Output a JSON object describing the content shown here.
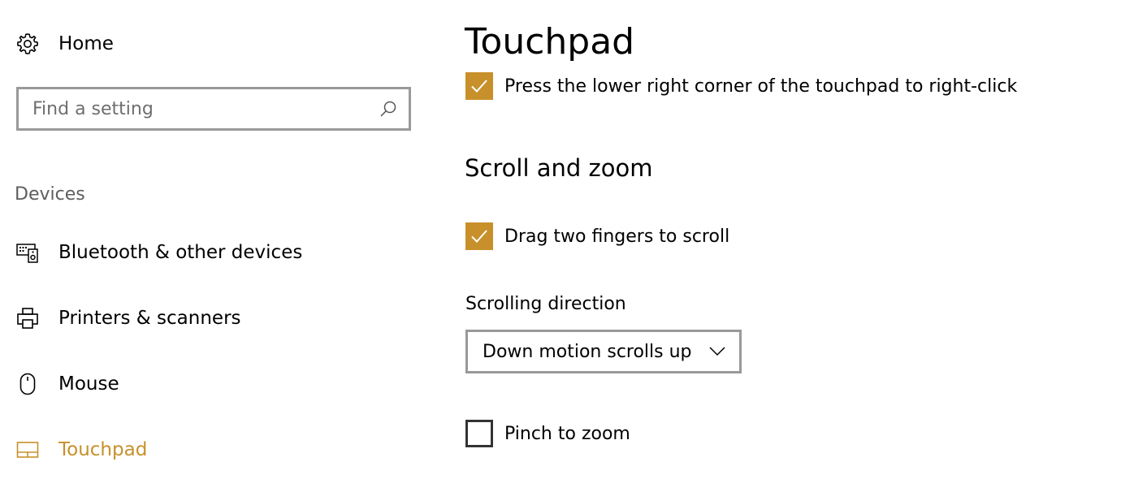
{
  "sidebar": {
    "home_label": "Home",
    "search": {
      "placeholder": "Find a setting",
      "value": ""
    },
    "section_header": "Devices",
    "items": [
      {
        "label": "Bluetooth & other devices",
        "icon": "bluetooth-devices-icon",
        "selected": false
      },
      {
        "label": "Printers & scanners",
        "icon": "printer-icon",
        "selected": false
      },
      {
        "label": "Mouse",
        "icon": "mouse-icon",
        "selected": false
      },
      {
        "label": "Touchpad",
        "icon": "touchpad-icon",
        "selected": true
      }
    ]
  },
  "main": {
    "title": "Touchpad",
    "right_click_option": {
      "label": "Press the lower right corner of the touchpad to right-click",
      "checked": true
    },
    "scroll_zoom": {
      "header": "Scroll and zoom",
      "two_finger_scroll": {
        "label": "Drag two fingers to scroll",
        "checked": true
      },
      "scrolling_direction": {
        "label": "Scrolling direction",
        "value": "Down motion scrolls up"
      },
      "pinch_to_zoom": {
        "label": "Pinch to zoom",
        "checked": false
      }
    }
  },
  "colors": {
    "accent": "#c8902a",
    "border": "#999999",
    "section_header": "#5e5e5e",
    "text": "#000000"
  }
}
